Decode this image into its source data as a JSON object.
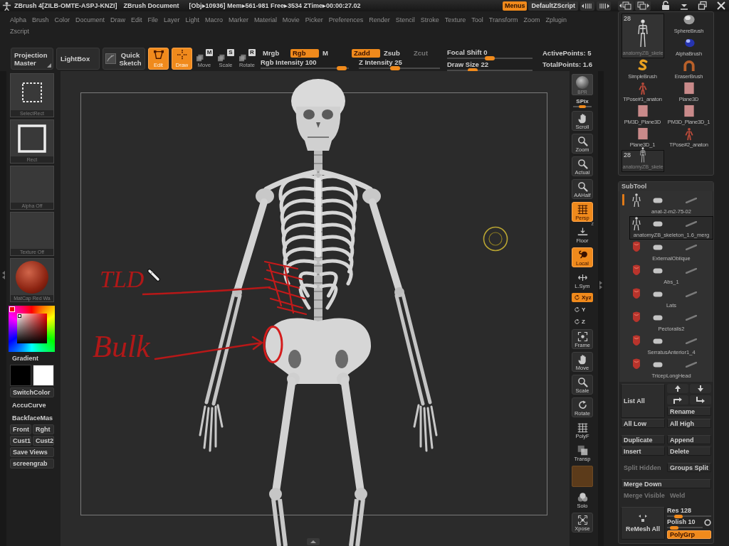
{
  "title_bar": {
    "app_title": "ZBrush 4[ZILB-OMTE-ASPJ-KNZI]",
    "document_title": "ZBrush Document",
    "stats": "[Obj▸10936] Mem▸561-981 Free▸3534 ZTime▸00:00:27.02",
    "menus_button": {
      "label": "Menus",
      "on": true
    },
    "script_button": "DefaultZScript"
  },
  "menu_bar": {
    "rows": [
      [
        "Alpha",
        "Brush",
        "Color",
        "Document",
        "Draw",
        "Edit",
        "File",
        "Layer",
        "Light",
        "Macro",
        "Marker",
        "Material",
        "Movie",
        "Picker",
        "Preferences",
        "Render",
        "Stencil",
        "Stroke",
        "Texture",
        "Tool",
        "Transform",
        "Zoom",
        "Zplugin"
      ],
      [
        "Zscript"
      ]
    ]
  },
  "top_shelf": {
    "buttons": [
      {
        "kind": "menu",
        "label": "Projection Master",
        "selected": false
      },
      {
        "kind": "text",
        "label": "LightBox",
        "selected": false
      },
      {
        "kind": "sketch",
        "label": "Quick Sketch",
        "selected": false
      },
      {
        "kind": "edit",
        "label": "Edit",
        "selected": true
      },
      {
        "kind": "draw",
        "label": "Draw",
        "selected": true
      },
      {
        "kind": "key",
        "label": "Move",
        "key": "M",
        "selected": false
      },
      {
        "kind": "key",
        "label": "Scale",
        "key": "S",
        "selected": false
      },
      {
        "kind": "key",
        "label": "Rotate",
        "key": "R",
        "selected": false
      }
    ],
    "color_modes": [
      {
        "label": "Mrgb",
        "selected": false
      },
      {
        "label": "Rgb",
        "selected": true
      },
      {
        "label": "M",
        "selected": false
      }
    ],
    "rgb_intensity": {
      "label": "Rgb Intensity 100",
      "level": 0.92
    },
    "z_modes": [
      {
        "label": "Zadd",
        "selected": true,
        "disabled": false
      },
      {
        "label": "Zsub",
        "selected": false,
        "disabled": false
      },
      {
        "label": "Zcut",
        "selected": false,
        "disabled": true
      }
    ],
    "z_intensity": {
      "label": "Z Intensity 25",
      "level": 0.45
    },
    "focal_shift": {
      "label": "Focal Shift 0",
      "level": 0.5
    },
    "draw_size": {
      "label": "Draw Size 22",
      "level": 0.3
    },
    "points": [
      "ActivePoints: 5",
      "TotalPoints: 1.6"
    ]
  },
  "left_shelf": {
    "tiles": [
      {
        "kind": "select_rect",
        "label": "SelectRect"
      },
      {
        "kind": "rect",
        "label": "Rect"
      },
      {
        "kind": "empty",
        "label": "Alpha Off"
      },
      {
        "kind": "empty",
        "label": "Texture Off"
      },
      {
        "kind": "material",
        "label": "MatCap Red Wa"
      }
    ],
    "gradient": {
      "label": "Gradient",
      "on": false
    },
    "swatches": [
      {
        "color": "#000000"
      },
      {
        "color": "#ffffff"
      }
    ],
    "button_rows": [
      [
        {
          "kind": "button",
          "label": "SwitchColor"
        }
      ],
      [
        {
          "kind": "switch",
          "label": "AccuCurve",
          "on": false
        }
      ],
      [
        {
          "kind": "switch",
          "label": "BackfaceMas",
          "on": false
        }
      ],
      [
        {
          "kind": "button",
          "label": "Front"
        },
        {
          "kind": "button",
          "label": "Rght"
        }
      ],
      [
        {
          "kind": "button",
          "label": "Cust1"
        },
        {
          "kind": "button",
          "label": "Cust2"
        }
      ],
      [
        {
          "kind": "button",
          "label": "Save Views"
        }
      ],
      [
        {
          "kind": "button",
          "label": "screengrab"
        }
      ]
    ]
  },
  "viewport": {
    "annotations": [
      {
        "kind": "hatch",
        "text": "TLD"
      },
      {
        "kind": "circle",
        "text": "Bulk"
      }
    ]
  },
  "view_toolbar": {
    "items": [
      {
        "kind": "render",
        "label": "BPR",
        "selected": false
      },
      {
        "kind": "slider",
        "label": "SPix",
        "level": 0.5
      },
      {
        "kind": "button",
        "label": "Scroll",
        "selected": false
      },
      {
        "kind": "button",
        "label": "Zoom",
        "selected": false
      },
      {
        "kind": "button",
        "label": "Actual",
        "selected": false
      },
      {
        "kind": "button",
        "label": "AAHalf",
        "selected": false
      },
      {
        "kind": "button",
        "label": "Persp",
        "selected": true
      },
      {
        "kind": "flat",
        "label": "Floor",
        "selected": false,
        "axis_label": "z"
      },
      {
        "kind": "button",
        "label": "Local",
        "selected": true
      },
      {
        "kind": "flat",
        "label": "L.Sym",
        "selected": false
      },
      {
        "kind": "axis",
        "label": "Xyz",
        "selected": true
      },
      {
        "kind": "axis",
        "label": "Y",
        "selected": false
      },
      {
        "kind": "axis",
        "label": "Z",
        "selected": false
      },
      {
        "kind": "button",
        "label": "Frame",
        "selected": false
      },
      {
        "kind": "button",
        "label": "Move",
        "selected": false
      },
      {
        "kind": "button",
        "label": "Scale",
        "selected": false
      },
      {
        "kind": "button",
        "label": "Rotate",
        "selected": false
      },
      {
        "kind": "flat",
        "label": "PolyF",
        "selected": false
      },
      {
        "kind": "flat",
        "label": "Transp",
        "selected": false
      },
      {
        "kind": "blank",
        "selected": false
      },
      {
        "kind": "flat",
        "label": "Solo",
        "selected": false
      },
      {
        "kind": "button",
        "label": "Xpose",
        "selected": false
      }
    ]
  },
  "tool_palette": {
    "tools": [
      {
        "kind": "skeleton",
        "label": "anatomyZB_skele",
        "count": "28",
        "selected": true
      },
      {
        "kind": "sphere",
        "label": "SphereBrush",
        "selected": false
      },
      {
        "kind": "alpha",
        "label": "AlphaBrush",
        "selected": false
      },
      {
        "kind": "simple",
        "label": "SimpleBrush",
        "selected": false
      },
      {
        "kind": "eraser",
        "label": "EraserBrush",
        "selected": false
      },
      {
        "kind": "figure",
        "label": "TPose#1_anaton",
        "selected": false
      },
      {
        "kind": "plane",
        "label": "Plane3D",
        "selected": false
      },
      {
        "kind": "plane",
        "label": "PM3D_Plane3D",
        "selected": false
      },
      {
        "kind": "plane",
        "label": "PM3D_Plane3D_1",
        "selected": false
      },
      {
        "kind": "plane",
        "label": "Plane3D_1",
        "selected": false
      },
      {
        "kind": "figure",
        "label": "TPose#2_anaton",
        "selected": false
      },
      {
        "kind": "skeleton",
        "label": "anatomyZB_skele",
        "count": "28",
        "selected": false
      }
    ]
  },
  "subtool": {
    "title": "SubTool",
    "entries": [
      {
        "name": "anat-2-m2-75-02",
        "kind": "skeleton",
        "selected": false
      },
      {
        "name": "anatomyZB_skeleton_1.6_merg",
        "kind": "skeleton",
        "selected": true
      },
      {
        "name": "ExternalOblique",
        "kind": "muscle",
        "selected": false
      },
      {
        "name": "Abs_1",
        "kind": "muscle",
        "selected": false
      },
      {
        "name": "Lats",
        "kind": "muscle",
        "selected": false
      },
      {
        "name": "Pectoralis2",
        "kind": "muscle",
        "selected": false
      },
      {
        "name": "SerratusAnterior1_4",
        "kind": "muscle",
        "selected": false
      },
      {
        "name": "TricepLongHead",
        "kind": "muscle",
        "selected": false
      }
    ],
    "list_all": "List All",
    "rename": "Rename",
    "button_groups": [
      [
        [
          {
            "label": "All Low",
            "disabled": false
          },
          {
            "label": "All High",
            "disabled": false
          }
        ]
      ],
      [
        [
          {
            "label": "Duplicate",
            "disabled": false
          },
          {
            "label": "Append",
            "disabled": false
          }
        ],
        [
          {
            "label": "Insert",
            "disabled": false
          },
          {
            "label": "Delete",
            "disabled": false
          }
        ]
      ],
      [
        [
          {
            "label": "Split Hidden",
            "disabled": true
          },
          {
            "label": "Groups Split",
            "disabled": false
          }
        ]
      ],
      [
        [
          {
            "label": "Merge Down",
            "disabled": false
          }
        ],
        [
          {
            "label": "Merge Visible",
            "disabled": true
          },
          {
            "label": "Weld",
            "disabled": true
          }
        ]
      ]
    ],
    "remesh": {
      "label": "ReMesh All",
      "res": {
        "label": "Res 128",
        "level": 0.25
      },
      "polish": {
        "label": "Polish 10",
        "level": 0.2
      },
      "polish_toggle": {
        "on": false
      },
      "polygrp": {
        "label": "PolyGrp",
        "on": true
      }
    }
  }
}
